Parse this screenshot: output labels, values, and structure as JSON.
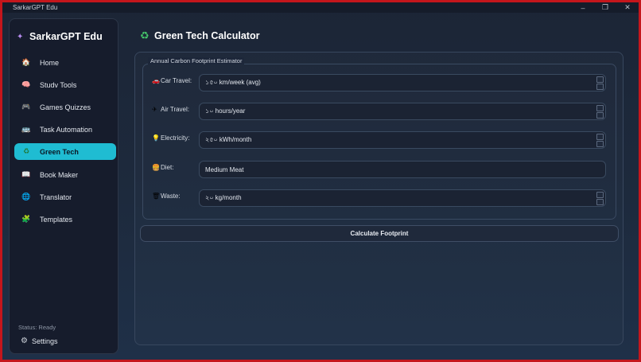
{
  "window": {
    "title": "SarkarGPT Edu",
    "controls": [
      "–",
      "❐",
      "✕"
    ]
  },
  "sidebar": {
    "brand": "SarkarGPT Edu",
    "items": [
      {
        "label": "Home",
        "icon": "🏠",
        "active": false
      },
      {
        "label": "Studv Tools",
        "icon": "🧠",
        "active": false
      },
      {
        "label": "Games  Quizzes",
        "icon": "🎮",
        "active": false
      },
      {
        "label": "Task Automation",
        "icon": "🚌",
        "active": false
      },
      {
        "label": "Green Tech",
        "icon": "♻",
        "active": true
      },
      {
        "label": "Book Maker",
        "icon": "📖",
        "active": false
      },
      {
        "label": "Translator",
        "icon": "🌐",
        "active": false
      },
      {
        "label": "Templates",
        "icon": "🧩",
        "active": false
      }
    ],
    "status": "Status: Ready",
    "settings_label": "Settings",
    "settings_icon": "⚙"
  },
  "page": {
    "title": "Green Tech Calculator",
    "title_icon": "♻"
  },
  "form": {
    "legend": "Annual Carbon Footprint Estimator",
    "fields": [
      {
        "label": "Car Travel:",
        "icon": "🚗",
        "value": "১৫০ km/week (avg)",
        "spinner": true
      },
      {
        "label": "Air Travel:",
        "icon": "✈",
        "value": "১০ hours/year",
        "spinner": true
      },
      {
        "label": "Electricity:",
        "icon": "💡",
        "value": "২৫০ kWh/month",
        "spinner": true
      },
      {
        "label": "Diet:",
        "icon": "🍔",
        "value": "Medium Meat",
        "spinner": false
      },
      {
        "label": "Waste:",
        "icon": "🗑",
        "value": "২০ kg/month",
        "spinner": true
      }
    ],
    "submit_label": "Calculate Footprint"
  },
  "colors": {
    "accent": "#1fbcd2",
    "sidebar_bg": "#161c2c",
    "border_frame": "#c4161c"
  }
}
